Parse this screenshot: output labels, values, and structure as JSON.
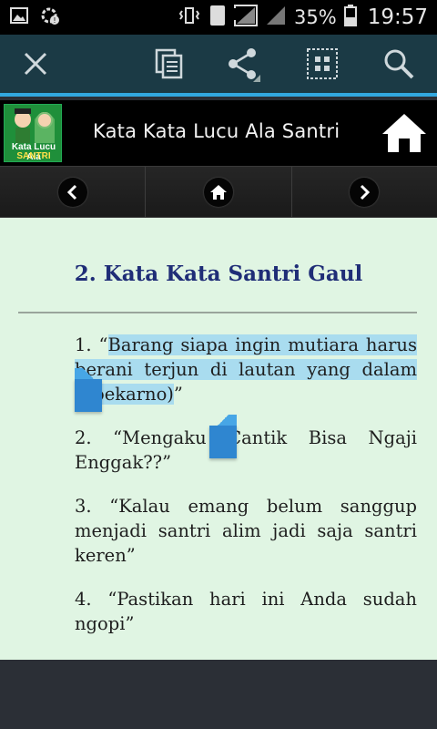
{
  "status_bar": {
    "sim_number": "1",
    "battery": "35%",
    "time": "19:57"
  },
  "action_bar": {
    "icons": [
      "close-icon",
      "copy-icon",
      "share-icon",
      "select-all-icon",
      "search-icon"
    ]
  },
  "header": {
    "title": "Kata Kata Lucu Ala Santri",
    "logo_line1": "Kata Lucu Ala",
    "logo_line2": "SANTRI"
  },
  "nav": {
    "icons": [
      "chevron-left-icon",
      "home-icon",
      "chevron-right-icon"
    ]
  },
  "content": {
    "title": "2. Kata Kata Santri Gaul",
    "items": [
      {
        "pre": "1. “",
        "highlight": "Barang siapa ingin mutiara harus berani terjun di lautan yang dalam (Soekarno)",
        "post": "”"
      },
      {
        "text": "2. “Mengaku Cantik Bisa Ngaji Enggak??”"
      },
      {
        "text": "3. “Kalau emang belum sanggup menjadi santri alim jadi saja santri keren”"
      },
      {
        "text": "4. “Pastikan hari ini Anda sudah ngopi”"
      }
    ]
  },
  "colors": {
    "accent": "#32a8e0",
    "title": "#1f2d77",
    "highlight": "#a9dcef",
    "content_bg": "#e0f5e3"
  }
}
